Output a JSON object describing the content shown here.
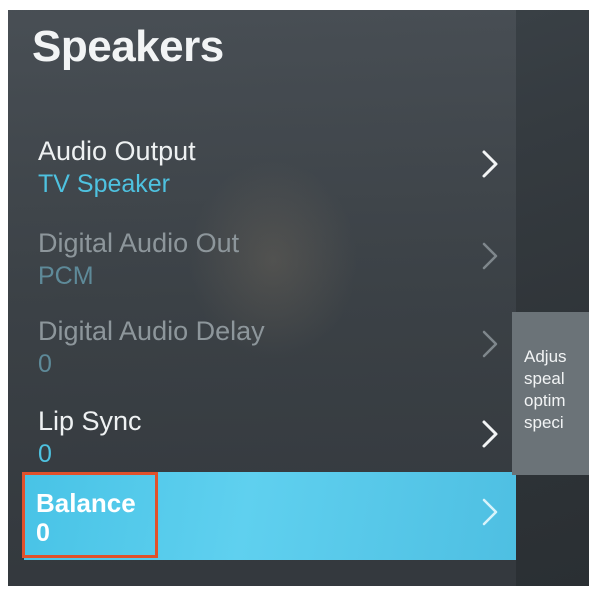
{
  "page": {
    "title": "Speakers"
  },
  "menu": {
    "items": [
      {
        "label": "Audio Output",
        "value": "TV Speaker",
        "enabled": true
      },
      {
        "label": "Digital Audio Out",
        "value": "PCM",
        "enabled": false
      },
      {
        "label": "Digital Audio Delay",
        "value": "0",
        "enabled": false
      },
      {
        "label": "Lip Sync",
        "value": "0",
        "enabled": true
      },
      {
        "label": "Balance",
        "value": "0",
        "enabled": true,
        "selected": true
      }
    ]
  },
  "help": {
    "lines": [
      "Adjus",
      "speal",
      "optim",
      "speci"
    ]
  },
  "icons": {
    "chevron": "chevron-right-icon"
  },
  "colors": {
    "accent": "#4ec2e0",
    "selected_row": "#55c9ea",
    "highlight_border": "#e0512b"
  }
}
